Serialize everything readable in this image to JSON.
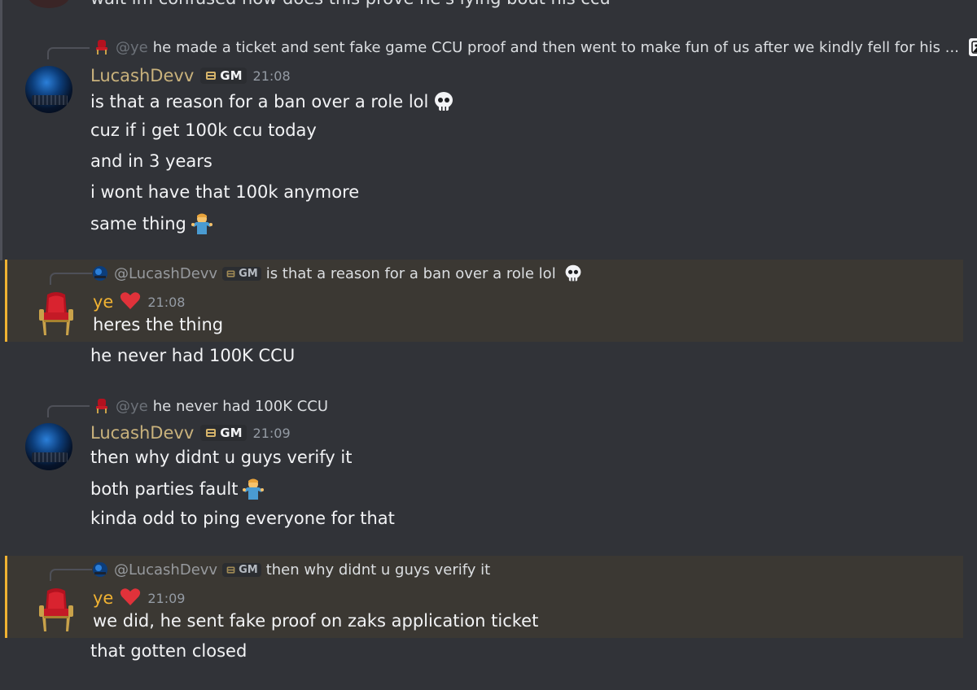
{
  "top_partial": {
    "text": "wait im confused now does this prove he's lying bout his ccu"
  },
  "messages": [
    {
      "reply": {
        "mention": "@ye",
        "text": "he made a ticket and sent fake game CCU proof and then went to make fun of us after we kindly fell for his ..."
      },
      "author": "LucashDevv",
      "tag": "GM",
      "time": "21:08",
      "lines": [
        "is that a reason for a ban over a role lol",
        "cuz if i get 100k ccu today",
        "and in 3 years",
        "i wont have that 100k anymore",
        "same thing"
      ]
    },
    {
      "reply": {
        "mention": "@LucashDevv",
        "tag": "GM",
        "text": "is that a reason for a ban over a role lol"
      },
      "author": "ye",
      "time": "21:08",
      "lines": [
        "heres the thing",
        "he never had 100K CCU"
      ]
    },
    {
      "reply": {
        "mention": "@ye",
        "text": "he never had 100K CCU"
      },
      "author": "LucashDevv",
      "tag": "GM",
      "time": "21:09",
      "lines": [
        "then why didnt u guys verify it",
        "both parties fault",
        "kinda odd to ping everyone for that"
      ]
    },
    {
      "reply": {
        "mention": "@LucashDevv",
        "tag": "GM",
        "text": "then why didnt u guys verify it"
      },
      "author": "ye",
      "time": "21:09",
      "lines": [
        "we did, he sent fake proof on zaks application ticket",
        "that gotten closed"
      ]
    }
  ],
  "colors": {
    "background": "#313338",
    "highlight_bg": "#3b3833",
    "highlight_bar": "#f0b232",
    "lucash_name": "#c9b27c",
    "ye_name": "#f0b232"
  },
  "icons": [
    "throne-avatar",
    "skull-emoji",
    "shrug-emoji",
    "heart-icon",
    "image-attachment-icon",
    "gm-tag-icon"
  ]
}
